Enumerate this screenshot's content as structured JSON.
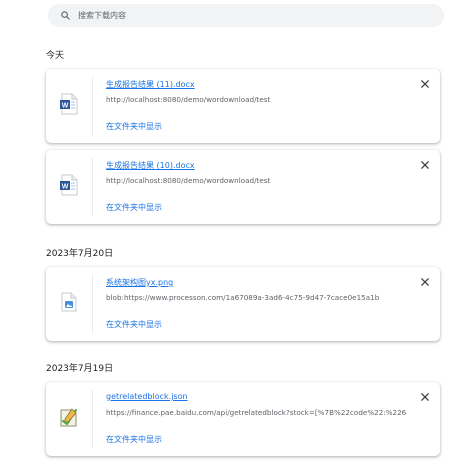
{
  "search": {
    "placeholder": "搜索下载内容"
  },
  "groups": [
    {
      "date": "今天",
      "items": [
        {
          "name": "生成报告结果 (11).docx",
          "url": "http://localhost:8080/demo/wordownload/test",
          "action": "在文件夹中显示",
          "icon": "word-doc-icon"
        },
        {
          "name": "生成报告结果 (10).docx",
          "url": "http://localhost:8080/demo/wordownload/test",
          "action": "在文件夹中显示",
          "icon": "word-doc-icon"
        }
      ]
    },
    {
      "date": "2023年7月20日",
      "items": [
        {
          "name": "系统架构图yx.png",
          "url": "blob:https://www.processon.com/1a67089a-3ad6-4c75-9d47-7cace0e15a1b",
          "action": "在文件夹中显示",
          "icon": "image-file-icon"
        }
      ]
    },
    {
      "date": "2023年7月19日",
      "items": [
        {
          "name": "getrelatedblock.json",
          "url": "https://finance.pae.baidu.com/api/getrelatedblock?stock=[%7B%22code%22:%22600",
          "action": "在文件夹中显示",
          "icon": "json-file-icon"
        }
      ]
    }
  ],
  "colors": {
    "link": "#1a73e8",
    "secondary_text": "#5f6368",
    "word_blue": "#2b579a",
    "search_bg": "#f1f3f4"
  }
}
